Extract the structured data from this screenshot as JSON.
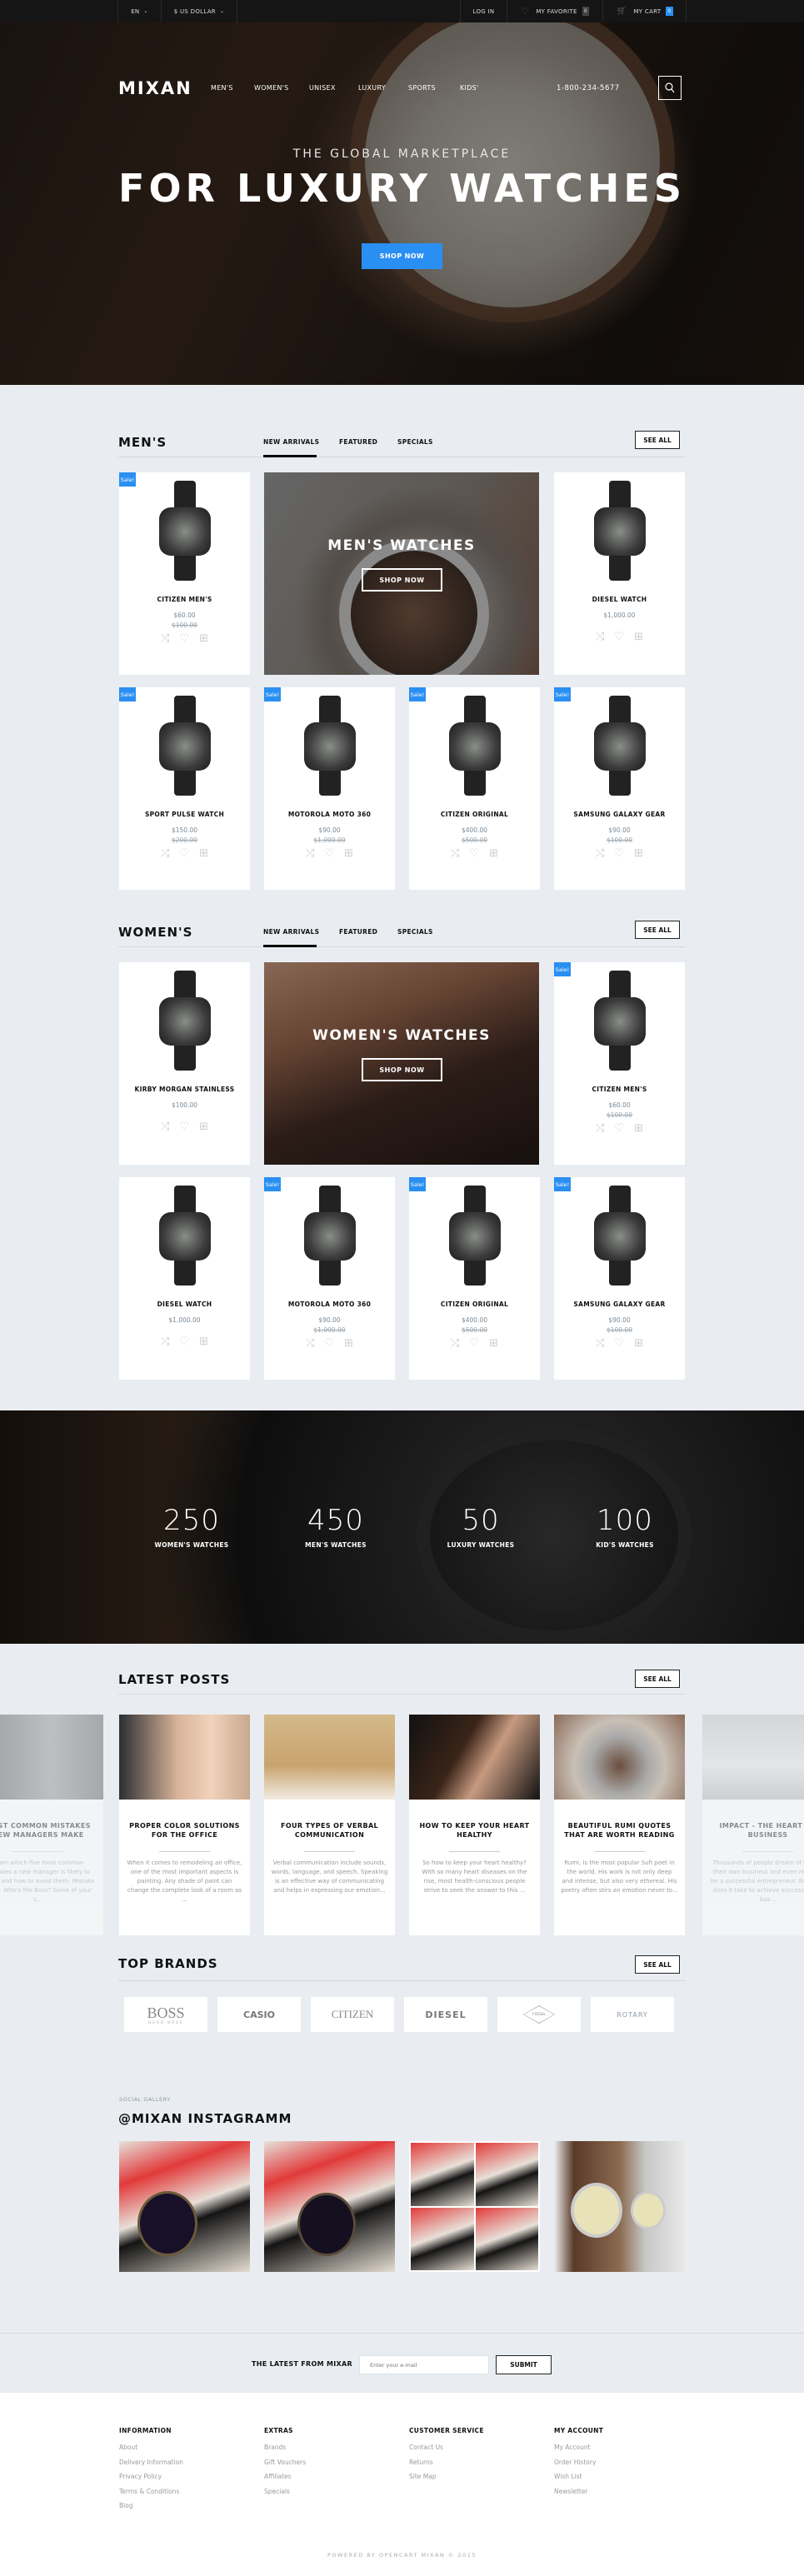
{
  "topbar": {
    "language": "EN",
    "currency": "$ US DOLLAR",
    "login": "LOG IN",
    "favorite_label": "MY FAVORITE",
    "favorite_count": "0",
    "cart_label": "MY CART",
    "cart_count": "0",
    "accent": "#2a8ff2"
  },
  "header": {
    "logo": "MIXAN",
    "nav": [
      "MEN'S",
      "WOMEN'S",
      "UNISEX",
      "LUXURY",
      "SPORTS",
      "KIDS'"
    ],
    "phone": "1-800-234-5677"
  },
  "hero": {
    "subtitle": "THE GLOBAL MARKETPLACE",
    "title": "FOR LUXURY WATCHES",
    "button": "SHOP NOW"
  },
  "mens": {
    "title": "MEN'S",
    "tabs": [
      "NEW ARRIVALS",
      "FEATURED",
      "SPECIALS"
    ],
    "see_all": "SEE ALL",
    "promo_title": "MEN'S WATCHES",
    "promo_button": "SHOP NOW",
    "products": [
      {
        "name": "CITIZEN MEN'S",
        "price": "$60.00",
        "old_price": "$100.00",
        "sale": "Sale!"
      },
      {
        "name": "DIESEL WATCH",
        "price": "$1,000.00",
        "old_price": "",
        "sale": ""
      },
      {
        "name": "SPORT PULSE WATCH",
        "price": "$150.00",
        "old_price": "$200.00",
        "sale": "Sale!"
      },
      {
        "name": "MOTOROLA MOTO 360",
        "price": "$90.00",
        "old_price": "$1,000.00",
        "sale": "Sale!"
      },
      {
        "name": "CITIZEN ORIGINAL",
        "price": "$400.00",
        "old_price": "$500.00",
        "sale": "Sale!"
      },
      {
        "name": "SAMSUNG GALAXY GEAR",
        "price": "$90.00",
        "old_price": "$100.00",
        "sale": "Sale!"
      }
    ]
  },
  "womens": {
    "title": "WOMEN'S",
    "tabs": [
      "NEW ARRIVALS",
      "FEATURED",
      "SPECIALS"
    ],
    "see_all": "SEE ALL",
    "promo_title": "WOMEN'S WATCHES",
    "promo_button": "SHOP NOW",
    "products": [
      {
        "name": "KIRBY MORGAN STAINLESS",
        "price": "$100.00",
        "old_price": "",
        "sale": ""
      },
      {
        "name": "CITIZEN MEN'S",
        "price": "$60.00",
        "old_price": "$100.00",
        "sale": "Sale!"
      },
      {
        "name": "DIESEL WATCH",
        "price": "$1,000.00",
        "old_price": "",
        "sale": ""
      },
      {
        "name": "MOTOROLA MOTO 360",
        "price": "$90.00",
        "old_price": "$1,000.00",
        "sale": "Sale!"
      },
      {
        "name": "CITIZEN ORIGINAL",
        "price": "$400.00",
        "old_price": "$500.00",
        "sale": "Sale!"
      },
      {
        "name": "SAMSUNG GALAXY GEAR",
        "price": "$90.00",
        "old_price": "$100.00",
        "sale": "Sale!"
      }
    ]
  },
  "stats": [
    {
      "value": "250",
      "label": "WOMEN'S WATCHES"
    },
    {
      "value": "450",
      "label": "MEN'S WATCHES"
    },
    {
      "value": "50",
      "label": "LUXURY WATCHES"
    },
    {
      "value": "100",
      "label": "KID'S WATCHES"
    }
  ],
  "posts": {
    "title": "LATEST POSTS",
    "see_all": "SEE ALL",
    "items": [
      {
        "title": "MOST COMMON MISTAKES NEW MANAGERS MAKE",
        "text": "Learn which five most common mistakes a new manager is likely to make, and how to avoid them. Mistake No.1 - Who's the Boss? Some of your s..."
      },
      {
        "title": "PROPER COLOR SOLUTIONS FOR THE OFFICE",
        "text": "When it comes to remodeling an office, one of the most important aspects is painting. Any shade of paint can change the complete look of a room as ..."
      },
      {
        "title": "FOUR TYPES OF VERBAL COMMUNICATION",
        "text": "Verbal communication include sounds, words, language, and speech. Speaking is an effective way of communicating and helps in expressing our emotion..."
      },
      {
        "title": "HOW TO KEEP YOUR HEART HEALTHY",
        "text": "So how to keep your heart healthy? With so many heart diseases on the rise, most health-conscious people strive to seek the answer to this ..."
      },
      {
        "title": "BEAUTIFUL RUMI QUOTES THAT ARE WORTH READING",
        "text": "Rumi, is the most popular Sufi poet in the world. His work is not only deep and intense, but also very ethereal. His poetry often stirs an emotion never to..."
      },
      {
        "title": "IMPACT - THE HEART OF BUSINESS",
        "text": "Thousands of people dream of having their own business and even more so be a successful entrepreneur. But what does it take to achieve success in the bus..."
      }
    ]
  },
  "brands": {
    "title": "TOP BRANDS",
    "see_all": "SEE ALL",
    "items": [
      "BOSS",
      "CASIO",
      "CITIZEN",
      "DIESEL",
      "FOSSIL",
      "ROTARY"
    ],
    "boss_sub": "HUGO BOSS"
  },
  "instagram": {
    "kicker": "SOCIAL GALLERY",
    "title": "@MIXAN INSTAGRAMM"
  },
  "newsletter": {
    "label": "THE LATEST FROM MIXAR",
    "placeholder": "Enter your e-mail",
    "button": "SUBMIT"
  },
  "footer": {
    "columns": [
      {
        "title": "INFORMATION",
        "links": [
          "About",
          "Delivery Information",
          "Privacy Policy",
          "Terms & Conditions",
          "Blog"
        ]
      },
      {
        "title": "EXTRAS",
        "links": [
          "Brands",
          "Gift Vouchers",
          "Affiliates",
          "Specials"
        ]
      },
      {
        "title": "CUSTOMER SERVICE",
        "links": [
          "Contact Us",
          "Returns",
          "Site Map"
        ]
      },
      {
        "title": "MY ACCOUNT",
        "links": [
          "My Account",
          "Order History",
          "Wish List",
          "Newsletter"
        ]
      }
    ],
    "copyright": "POWERED BY OPENCART MIXAN © 2015"
  }
}
